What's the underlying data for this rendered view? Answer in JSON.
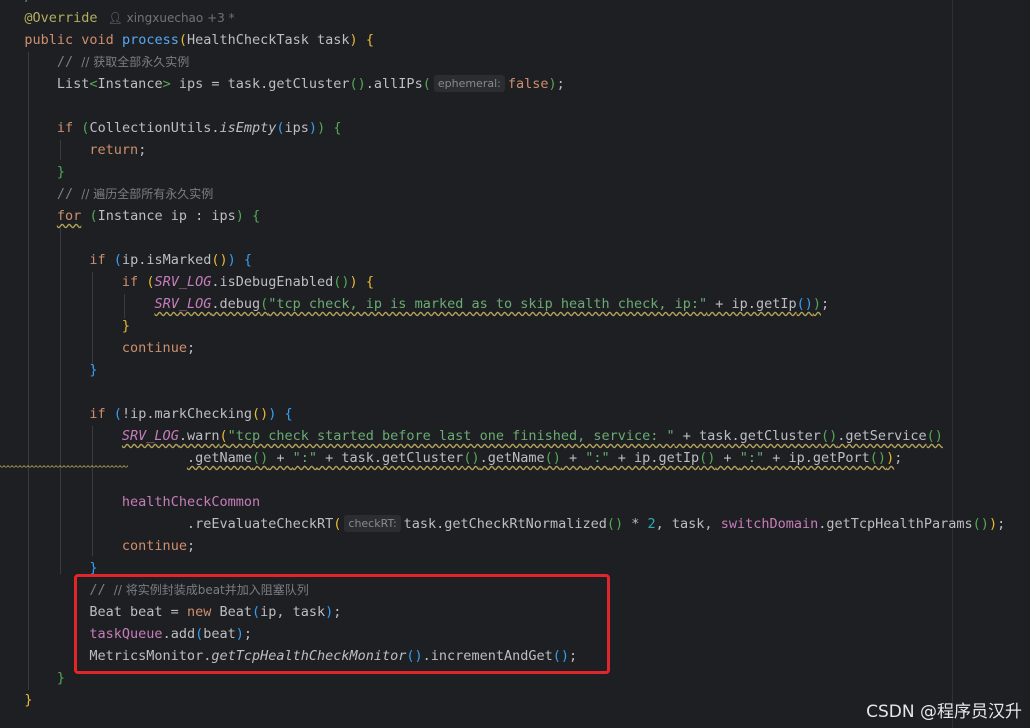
{
  "editor": {
    "author": {
      "name": "xingxuechao",
      "extra": "+3 *"
    },
    "hints": {
      "ephemeral": "ephemeral:",
      "checkRT": "checkRT:"
    },
    "comments": {
      "get_all": "// 获取全部永久实例",
      "iterate_all": "// 遍历全部所有永久实例",
      "wrap_beat": "// 将实例封装成beat并加入阻塞队列"
    },
    "strings": {
      "debug_msg": "\"tcp check, ip is marked as to skip health check, ip:\"",
      "warn_msg": "\"tcp check started before last one finished, service: \"",
      "colon": "\":\""
    },
    "numbers": {
      "two": "2"
    }
  },
  "highlight": {
    "color": "#e0262a"
  },
  "watermark": {
    "text": "CSDN @程序员汉升"
  },
  "colors": {
    "background": "#1e1f22",
    "keyword": "#cf8e6d",
    "function": "#56a8f5",
    "string": "#6aab73",
    "comment": "#7a7e85",
    "static": "#c77dbb"
  }
}
